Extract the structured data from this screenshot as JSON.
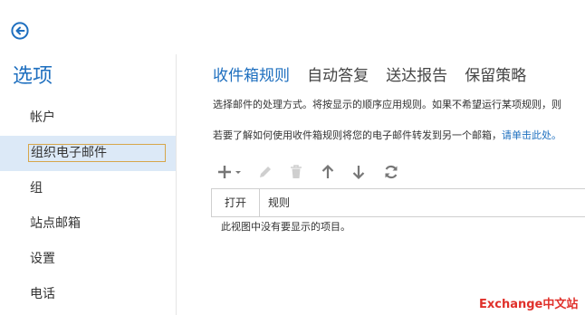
{
  "left_title": "选项",
  "sidebar": {
    "items": [
      {
        "label": "帐户"
      },
      {
        "label": "组织电子邮件"
      },
      {
        "label": "组"
      },
      {
        "label": "站点邮箱"
      },
      {
        "label": "设置"
      },
      {
        "label": "电话"
      }
    ]
  },
  "tabs": [
    "收件箱规则",
    "自动答复",
    "送达报告",
    "保留策略"
  ],
  "description": {
    "line1": "选择邮件的处理方式。将按显示的顺序应用规则。如果不希望运行某项规则，则",
    "line2_prefix": "若要了解如何使用收件箱规则将您的电子邮件转发到另一个邮箱，",
    "line2_link": "请单击此处。"
  },
  "toolbar": {
    "icons": [
      "add-icon",
      "edit-icon",
      "delete-icon",
      "move-up-icon",
      "move-down-icon",
      "refresh-icon"
    ]
  },
  "table": {
    "columns": [
      "打开",
      "规则"
    ],
    "empty_message": "此视图中没有要显示的项目。"
  },
  "watermark": "Exchange中文站",
  "colors": {
    "accent": "#1e6fbf",
    "selected_bg": "#dce9f7",
    "watermark": "#e0302a"
  }
}
